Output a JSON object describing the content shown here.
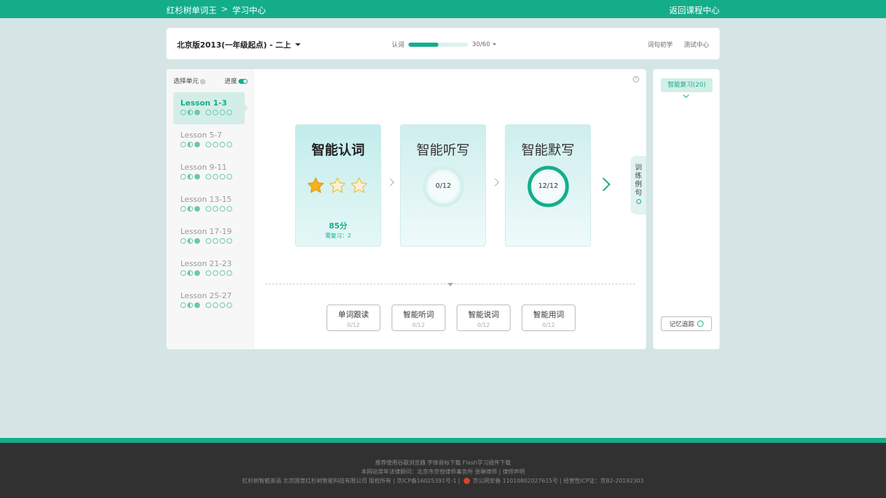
{
  "topbar": {
    "brand": "红杉树单词王",
    "separator": ">",
    "section": "学习中心",
    "back_link": "返回课程中心"
  },
  "header": {
    "book": "北京版2013(一年级起点) - 二上",
    "progress_label": "认词",
    "progress_fraction": 0.5,
    "progress_text": "30/60",
    "links": [
      "词句初学",
      "测试中心"
    ]
  },
  "sidebar": {
    "select_unit": "选择单元",
    "progress_toggle": "进度",
    "lessons": [
      {
        "name": "Lesson 1-3",
        "active": true
      },
      {
        "name": "Lesson 5-7",
        "active": false
      },
      {
        "name": "Lesson 9-11",
        "active": false
      },
      {
        "name": "Lesson 13-15",
        "active": false
      },
      {
        "name": "Lesson 17-19",
        "active": false
      },
      {
        "name": "Lesson 21-23",
        "active": false
      },
      {
        "name": "Lesson 25-27",
        "active": false
      }
    ]
  },
  "cards": [
    {
      "title": "智能认词",
      "stars": 1,
      "stars_max": 3,
      "score": "85分",
      "review": "需复习：2"
    },
    {
      "title": "智能听写",
      "progress_text": "0/12",
      "progress": 0
    },
    {
      "title": "智能默写",
      "progress_text": "12/12",
      "progress": 1
    }
  ],
  "side_tab": {
    "label": "训练例句"
  },
  "practice_buttons": [
    {
      "label": "单词跟读",
      "count": "0/12"
    },
    {
      "label": "智能听词",
      "count": "0/12"
    },
    {
      "label": "智能说词",
      "count": "0/12"
    },
    {
      "label": "智能用词",
      "count": "0/12"
    }
  ],
  "right_panel": {
    "review_button": "智能复习(20)",
    "memory_button": "记忆追踪"
  },
  "footer": {
    "line1": "推荐使用谷歌浏览器  字体音标下载  Flash学习插件下载",
    "line2": "本网站常年法律顾问：北京市京悦律师事务所 张琳律师 | 律师声明",
    "line3a": "红杉树智能英语 北京国育红杉树智能科技有限公司 版权所有 | 京ICP备16025391号-1 |",
    "line3b": "京公网安备 11010802027615号 | 经营性ICP证：京B2-20192303"
  },
  "colors": {
    "accent": "#14ad8a",
    "background": "#d5e5e5",
    "footer": "#313131"
  }
}
